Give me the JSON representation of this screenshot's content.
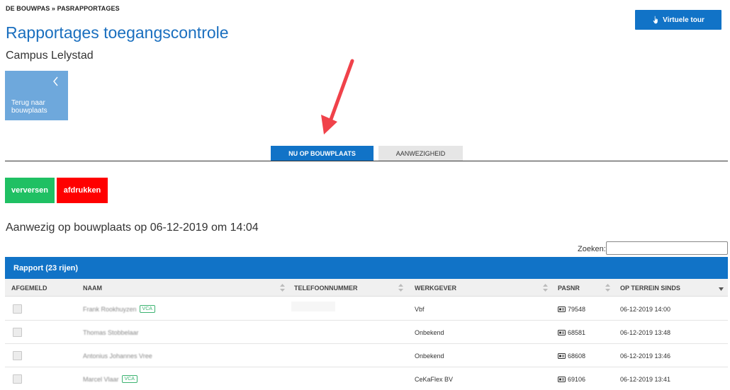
{
  "breadcrumb": "DE BOUWPAS » PASRAPPORTAGES",
  "title": "Rapportages toegangscontrole",
  "subtitle": "Campus Lelystad",
  "tour_button": "Virtuele tour",
  "back_tile": "Terug naar bouwplaats",
  "tabs": [
    {
      "label": "NU OP BOUWPLAATS",
      "active": true
    },
    {
      "label": "AANWEZIGHEID",
      "active": false
    }
  ],
  "buttons": {
    "refresh": "verversen",
    "print": "afdrukken"
  },
  "section_heading": "Aanwezig op bouwplaats op 06-12-2019 om 14:04",
  "search": {
    "label": "Zoeken:",
    "value": ""
  },
  "report_bar": "Rapport (23 rijen)",
  "columns": [
    "AFGEMELD",
    "NAAM",
    "TELEFOONNUMMER",
    "WERKGEVER",
    "PASNR",
    "OP TERREIN SINDS"
  ],
  "rows": [
    {
      "name": "Frank Rookhuyzen",
      "vca": "VCA",
      "phone": "",
      "employer": "Vbf",
      "pasnr": "79548",
      "since": "06-12-2019 14:00"
    },
    {
      "name": "Thomas Stobbelaar",
      "vca": "",
      "phone": "",
      "employer": "Onbekend",
      "pasnr": "68581",
      "since": "06-12-2019 13:48"
    },
    {
      "name": "Antonius Johannes Vree",
      "vca": "",
      "phone": "",
      "employer": "Onbekend",
      "pasnr": "68608",
      "since": "06-12-2019 13:46"
    },
    {
      "name": "Marcel Vlaar",
      "vca": "VCA",
      "phone": "",
      "employer": "CeKaFlex BV",
      "pasnr": "69106",
      "since": "06-12-2019 13:41"
    }
  ],
  "colors": {
    "primary": "#1173c7",
    "title": "#1a6fbf",
    "tile": "#6ea8dc",
    "green": "#1fc063",
    "red": "#ff0000",
    "arrow": "#f0424a"
  }
}
